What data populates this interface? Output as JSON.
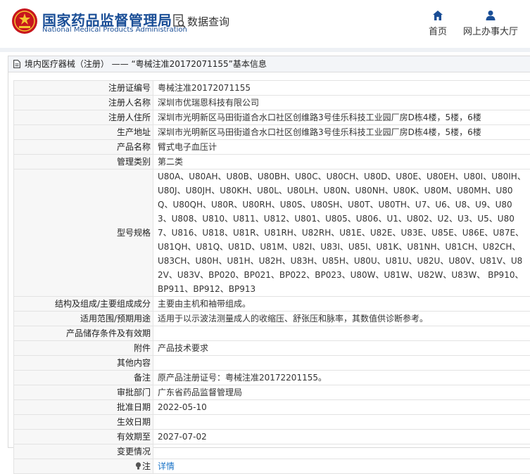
{
  "header": {
    "site_name": "国家药品监督管理局",
    "site_name_en": "National Medical Products Administration",
    "search_title": "数据查询",
    "nav": {
      "home": "首页",
      "online_hall": "网上办事大厅"
    },
    "brand_color": "#1a4e96"
  },
  "panel": {
    "title": "境内医疗器械（注册） —— “粤械注准20172071155”基本信息"
  },
  "record": {
    "rows": [
      {
        "label": "注册证编号",
        "value": "粤械注准20172071155"
      },
      {
        "label": "注册人名称",
        "value": "深圳市优瑞恩科技有限公司"
      },
      {
        "label": "注册人住所",
        "value": "深圳市光明新区马田街道合水口社区创维路3号佳乐科技工业园厂房D栋4楼，5楼，6楼"
      },
      {
        "label": "生产地址",
        "value": "深圳市光明新区马田街道合水口社区创维路3号佳乐科技工业园厂房D栋4楼，5楼，6楼"
      },
      {
        "label": "产品名称",
        "value": "臂式电子血压计"
      },
      {
        "label": "管理类别",
        "value": "第二类"
      },
      {
        "label": "型号规格",
        "value": "U80A、U80AH、U80B、U80BH、U80C、U80CH、U80D、U80E、U80EH、U80I、U80IH、U80J、U80JH、U80KH、U80L、U80LH、U80N、U80NH、U80K、U80M、U80MH、U80Q、U80QH、U80R、U80RH、U80S、U80SH、U80T、U80TH、U7、U6、U8、U9、U803、U808、U810、U811、U812、U801、U805、U806、U1、U802、U2、U3、U5、U807、U816、U818、U81R、U81RH、U82RH、U81E、U82E、U83E、U85E、U86E、U87E、U81QH、U81Q、U81D、U81M、U82I、U83I、U85I、U81K、U81NH、U81CH、U82CH、U83CH、U80H、U81H、U82H、U83H、U85H、U80U、U81U、U82U、U80V、U81V、U82V、U83V、BP020、BP021、BP022、BP023、U80W、U81W、U82W、U83W、 BP910、 BP911、BP912、BP913"
      },
      {
        "label": "结构及组成/主要组成成分",
        "value": "主要由主机和袖带组成。"
      },
      {
        "label": "适用范围/预期用途",
        "value": "适用于以示波法测量成人的收缩压、舒张压和脉率，其数值供诊断参考。"
      },
      {
        "label": "产品储存条件及有效期",
        "value": ""
      },
      {
        "label": "附件",
        "value": "产品技术要求"
      },
      {
        "label": "其他内容",
        "value": ""
      },
      {
        "label": "备注",
        "value": "原产品注册证号：粤械注准20172201155。"
      },
      {
        "label": "审批部门",
        "value": "广东省药品监督管理局"
      },
      {
        "label": "批准日期",
        "value": "2022-05-10"
      },
      {
        "label": "生效日期",
        "value": ""
      },
      {
        "label": "有效期至",
        "value": "2027-07-02"
      },
      {
        "label": "变更情况",
        "value": ""
      }
    ],
    "note": {
      "label": "注",
      "link_text": "详情"
    }
  }
}
